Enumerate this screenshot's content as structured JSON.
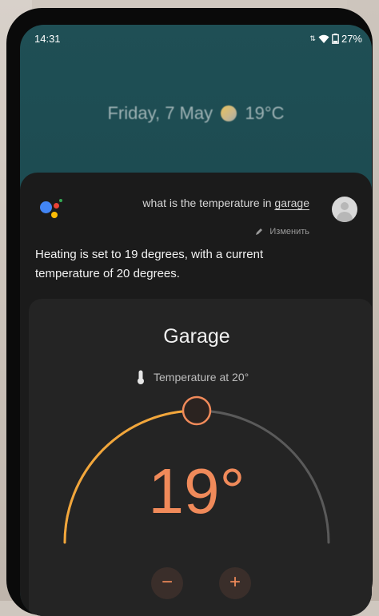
{
  "status_bar": {
    "time": "14:31",
    "battery": "27%"
  },
  "lockscreen": {
    "date_text": "Friday, 7 May",
    "weather_temp": "19°C",
    "weather_icon": "partly-cloudy-icon"
  },
  "assistant": {
    "query_prefix": "what is the temperature in ",
    "query_keyword": "garage",
    "edit_label": "Изменить",
    "answer_text": "Heating is set to 19 degrees, with a current temperature of 20 degrees."
  },
  "thermostat": {
    "room_name": "Garage",
    "temperature_label": "Temperature at 20°",
    "setpoint_display": "19°",
    "setpoint_fraction": 0.5,
    "minus_label": "−",
    "plus_label": "+"
  },
  "colors": {
    "accent": "#f08a5a",
    "arc_active": "#f2a63a",
    "arc_inactive": "#5a5a5a",
    "google_blue": "#4285F4",
    "google_red": "#EA4335",
    "google_yellow": "#FBBC05",
    "google_green": "#34A853"
  }
}
